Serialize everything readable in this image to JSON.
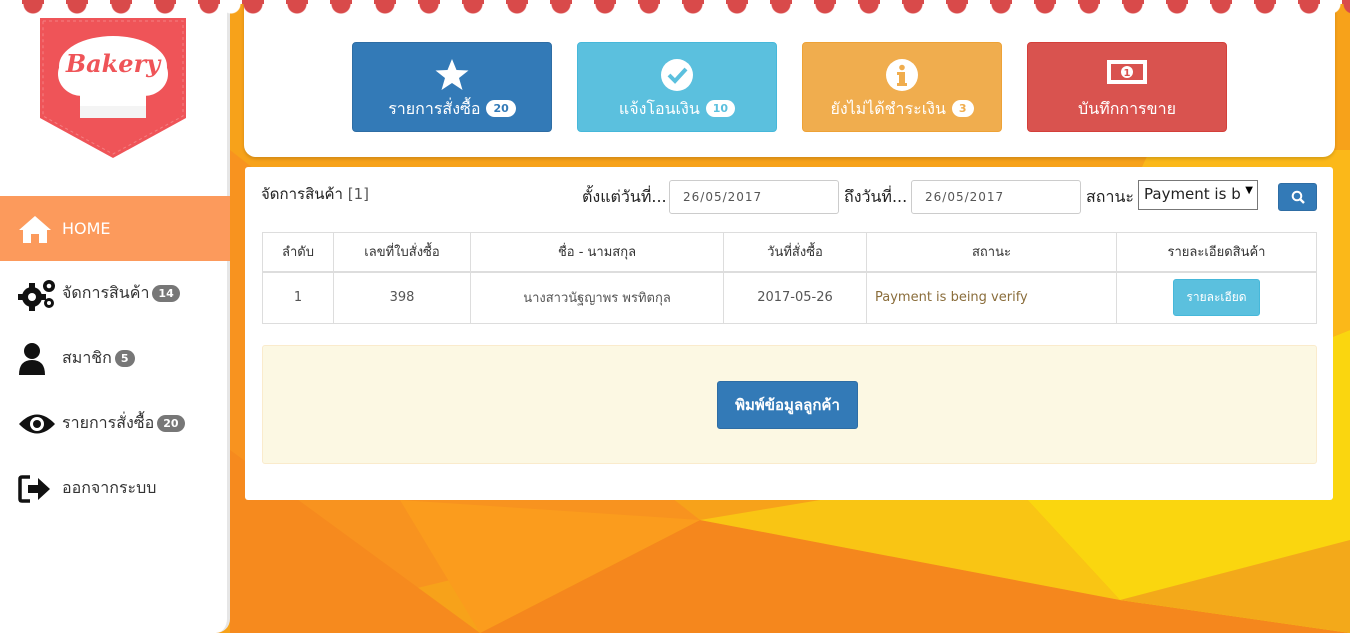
{
  "app": {
    "logo_text": "Bakery",
    "colors": {
      "accent": "#fc9a5c",
      "primary": "#337ab7",
      "info": "#5bc0de",
      "warning": "#f0ad4e",
      "danger": "#d9534f"
    }
  },
  "sidebar": {
    "items": [
      {
        "label": "HOME",
        "icon": "home-icon",
        "badge": ""
      },
      {
        "label": "จัดการสินค้า",
        "icon": "gears-icon",
        "badge": "14"
      },
      {
        "label": "สมาชิก",
        "icon": "user-icon",
        "badge": "5"
      },
      {
        "label": "รายการสั่งซื้อ",
        "icon": "eye-icon",
        "badge": "20"
      },
      {
        "label": "ออกจากระบบ",
        "icon": "sign-out-icon",
        "badge": ""
      }
    ]
  },
  "tiles": [
    {
      "label": "รายการสั่งซื้อ",
      "badge": "20",
      "icon": "star-icon"
    },
    {
      "label": "แจ้งโอนเงิน",
      "badge": "10",
      "icon": "check-circle-icon"
    },
    {
      "label": "ยังไม่ได้ชำระเงิน",
      "badge": "3",
      "icon": "info-circle-icon"
    },
    {
      "label": "บันทึกการขาย",
      "badge": "",
      "icon": "money-icon"
    }
  ],
  "main": {
    "title": "จัดการสินค้า",
    "title_count": "[1]",
    "filter": {
      "from_label": "ตั้งแต่วันที่...",
      "from_value": "26/05/2017",
      "to_label": "ถึงวันที่...",
      "to_value": "26/05/2017",
      "status_label": "สถานะ",
      "status_value": "Payment is b"
    },
    "table": {
      "headers": [
        "ลำดับ",
        "เลขที่ใบสั่งซื้อ",
        "ชื่อ - นามสกุล",
        "วันที่สั่งซื้อ",
        "สถานะ",
        "รายละเอียดสินค้า"
      ],
      "rows": [
        {
          "no": "1",
          "order_id": "398",
          "name": "นางสาวนัฐญาพร พรทิตกุล",
          "date": "2017-05-26",
          "status": "Payment is being verify",
          "action": "รายละเอียด"
        }
      ]
    },
    "print_label": "พิมพ์ข้อมูลลูกค้า"
  }
}
